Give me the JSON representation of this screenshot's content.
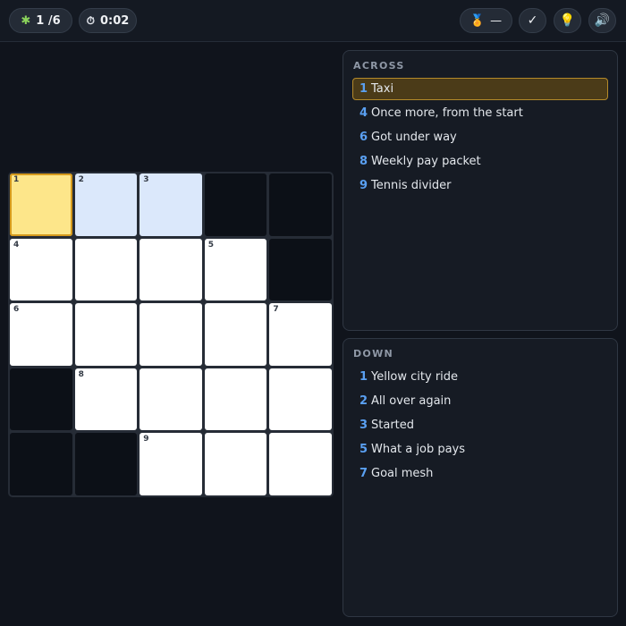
{
  "header": {
    "progress": "1 /6",
    "timer": "0:02",
    "medal_value": "—",
    "icons": {
      "puzzle": "puzzle-piece",
      "timer": "stopwatch",
      "medal": "medal",
      "check": "checkmark",
      "hint": "lightbulb",
      "sound": "speaker"
    }
  },
  "grid": {
    "size": 5,
    "cells": [
      {
        "type": "letter",
        "num": "1",
        "state": "active"
      },
      {
        "type": "letter",
        "num": "2",
        "state": "word"
      },
      {
        "type": "letter",
        "num": "3",
        "state": "word"
      },
      {
        "type": "block"
      },
      {
        "type": "block"
      },
      {
        "type": "letter",
        "num": "4"
      },
      {
        "type": "letter"
      },
      {
        "type": "letter"
      },
      {
        "type": "letter",
        "num": "5"
      },
      {
        "type": "block"
      },
      {
        "type": "letter",
        "num": "6"
      },
      {
        "type": "letter"
      },
      {
        "type": "letter"
      },
      {
        "type": "letter"
      },
      {
        "type": "letter",
        "num": "7"
      },
      {
        "type": "block"
      },
      {
        "type": "letter",
        "num": "8"
      },
      {
        "type": "letter"
      },
      {
        "type": "letter"
      },
      {
        "type": "letter"
      },
      {
        "type": "block"
      },
      {
        "type": "block"
      },
      {
        "type": "letter",
        "num": "9"
      },
      {
        "type": "letter"
      },
      {
        "type": "letter"
      }
    ]
  },
  "across": {
    "title": "ACROSS",
    "clues": [
      {
        "num": "1",
        "text": "Taxi",
        "active": true
      },
      {
        "num": "4",
        "text": "Once more, from the start"
      },
      {
        "num": "6",
        "text": "Got under way"
      },
      {
        "num": "8",
        "text": "Weekly pay packet"
      },
      {
        "num": "9",
        "text": "Tennis divider"
      }
    ]
  },
  "down": {
    "title": "DOWN",
    "clues": [
      {
        "num": "1",
        "text": "Yellow city ride"
      },
      {
        "num": "2",
        "text": "All over again"
      },
      {
        "num": "3",
        "text": "Started"
      },
      {
        "num": "5",
        "text": "What a job pays"
      },
      {
        "num": "7",
        "text": "Goal mesh"
      }
    ]
  }
}
